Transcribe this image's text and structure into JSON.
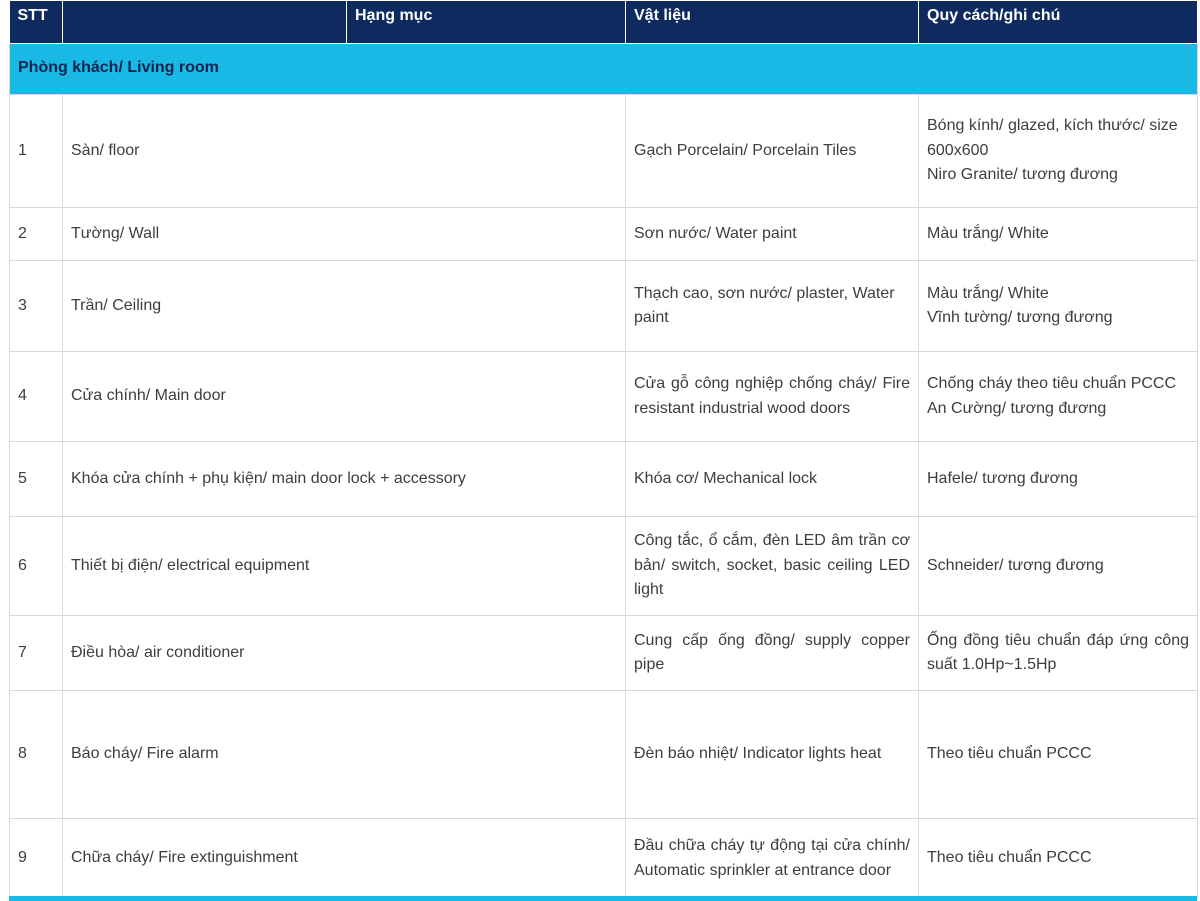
{
  "table": {
    "headers": [
      "STT",
      "Hạng mục",
      "Vật liệu",
      "Quy cách/ghi chú"
    ],
    "section": "Phòng khách/ Living room",
    "rows": [
      {
        "stt": "1",
        "item": "Sàn/ floor",
        "material": [
          "Gạch Porcelain/ Porcelain Tiles"
        ],
        "spec": [
          "Bóng kính/ glazed, kích thước/ size 600x600",
          "Niro Granite/ tương đương"
        ]
      },
      {
        "stt": "2",
        "item": "Tường/ Wall",
        "material": [
          "Sơn nước/ Water paint"
        ],
        "spec": [
          "Màu trắng/ White"
        ]
      },
      {
        "stt": "3",
        "item": "Trần/ Ceiling",
        "material": [
          "Thạch cao, sơn nước/ plaster, Water paint"
        ],
        "spec": [
          "Màu trắng/ White",
          "Vĩnh tường/ tương đương"
        ]
      },
      {
        "stt": "4",
        "item": "Cửa chính/ Main door",
        "material": [
          "Cửa gỗ công nghiệp chống cháy/ Fire resistant industrial wood doors"
        ],
        "spec": [
          "Chống cháy theo tiêu chuẩn PCCC",
          "An Cường/ tương đương"
        ]
      },
      {
        "stt": "5",
        "item": "Khóa cửa chính + phụ kiện/ main door lock + accessory",
        "material": [
          "Khóa cơ/ Mechanical lock"
        ],
        "spec": [
          "Hafele/ tương đương"
        ]
      },
      {
        "stt": "6",
        "item": "Thiết bị điện/ electrical equipment",
        "material": [
          "Công tắc, ổ cắm, đèn LED âm trần cơ bản/ switch, socket, basic ceiling LED light"
        ],
        "spec": [
          "Schneider/ tương đương"
        ]
      },
      {
        "stt": "7",
        "item": "Điều hòa/ air conditioner",
        "material": [
          "Cung cấp ống đồng/ supply copper pipe"
        ],
        "spec": [
          "Ống đồng tiêu chuẩn đáp ứng công suất 1.0Hp~1.5Hp"
        ]
      },
      {
        "stt": "8",
        "item": "Báo cháy/ Fire alarm",
        "material": [
          "Đèn báo nhiệt/ Indicator lights heat"
        ],
        "spec": [
          "Theo tiêu chuẩn PCCC"
        ]
      },
      {
        "stt": "9",
        "item": "Chữa cháy/ Fire extinguishment",
        "material": [
          "Đầu chữa cháy tự động tại cửa chính/ Automatic sprinkler at entrance door"
        ],
        "spec": [
          "Theo tiêu chuẩn PCCC"
        ]
      }
    ]
  },
  "colors": {
    "header_bg": "#0e2a5e",
    "section_bg": "#1ab8e4",
    "border": "#d9d9d9"
  }
}
